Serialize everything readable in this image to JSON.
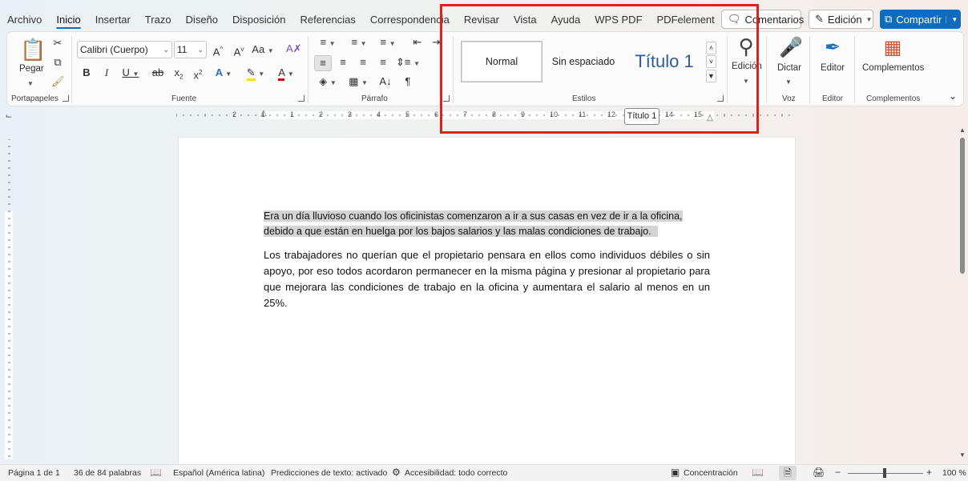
{
  "tabs": [
    "Archivo",
    "Inicio",
    "Insertar",
    "Trazo",
    "Diseño",
    "Disposición",
    "Referencias",
    "Correspondencia",
    "Revisar",
    "Vista",
    "Ayuda",
    "WPS PDF",
    "PDFelement"
  ],
  "top": {
    "comments": "Comentarios",
    "edit_mode": "Edición",
    "share": "Compartir"
  },
  "ribbon": {
    "clipboard": {
      "paste": "Pegar",
      "label": "Portapapeles"
    },
    "font": {
      "name": "Calibri (Cuerpo)",
      "size": "11",
      "label": "Fuente"
    },
    "paragraph": {
      "label": "Párrafo"
    },
    "styles": {
      "normal": "Normal",
      "no_spacing": "Sin espaciado",
      "heading1": "Título 1",
      "label": "Estilos"
    },
    "editing": {
      "label": "Edición"
    },
    "voice": {
      "dictate": "Dictar",
      "label": "Voz"
    },
    "editor": {
      "button": "Editor",
      "label": "Editor"
    },
    "addins": {
      "button": "Complementos",
      "label": "Complementos"
    }
  },
  "tooltip": "Título 1",
  "ruler_numbers": [
    "2",
    "1",
    "1",
    "2",
    "3",
    "4",
    "5",
    "6",
    "7",
    "8",
    "9",
    "10",
    "11",
    "12",
    "13",
    "14",
    "15"
  ],
  "document": {
    "p1_line1": "Era un día lluvioso cuando los oficinistas comenzaron a ir a sus casas en vez de ir a la oficina,",
    "p1_line2": "debido a que están en huelga por los bajos salarios y las malas condiciones de trabajo.",
    "p2": "Los trabajadores no querían que el propietario pensara en ellos como individuos débiles o sin apoyo, por eso todos acordaron permanecer en la misma página y presionar al propietario para que mejorara las condiciones de trabajo en la oficina y aumentara el salario al menos en un 25%."
  },
  "status": {
    "page": "Página 1 de 1",
    "words": "36 de 84 palabras",
    "language": "Español (América latina)",
    "predictions": "Predicciones de texto: activado",
    "accessibility": "Accesibilidad: todo correcto",
    "focus": "Concentración",
    "zoom": "100 %"
  },
  "colors": {
    "accent": "#0f6cbd",
    "highlight_border": "#e0201b"
  }
}
